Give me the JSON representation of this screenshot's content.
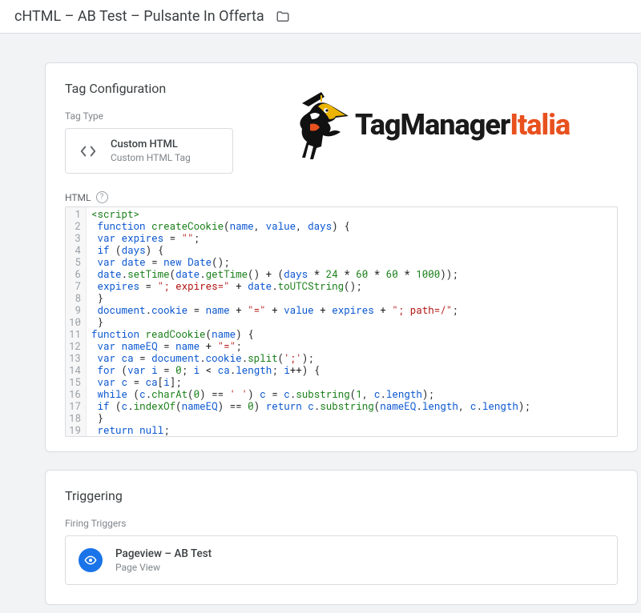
{
  "header": {
    "title": "cHTML – AB Test – Pulsante In Offerta"
  },
  "tag_config": {
    "section_title": "Tag Configuration",
    "tag_type_label": "Tag Type",
    "tag_type": {
      "primary": "Custom HTML",
      "secondary": "Custom HTML Tag"
    },
    "html_label": "HTML",
    "help_glyph": "?"
  },
  "logo": {
    "text_black": "TagManager",
    "text_orange": "Italia"
  },
  "triggering": {
    "section_title": "Triggering",
    "firing_label": "Firing Triggers",
    "trigger": {
      "primary": "Pageview – AB Test",
      "secondary": "Page View"
    }
  },
  "code": {
    "lines": [
      {
        "n": "1",
        "tokens": [
          {
            "c": "t-tag",
            "t": "<script>"
          }
        ]
      },
      {
        "n": "2",
        "tokens": [
          {
            "c": "t-plain",
            "t": " "
          },
          {
            "c": "t-key",
            "t": "function"
          },
          {
            "c": "t-plain",
            "t": " "
          },
          {
            "c": "t-fn",
            "t": "createCookie"
          },
          {
            "c": "t-plain",
            "t": "("
          },
          {
            "c": "t-id",
            "t": "name"
          },
          {
            "c": "t-plain",
            "t": ", "
          },
          {
            "c": "t-id",
            "t": "value"
          },
          {
            "c": "t-plain",
            "t": ", "
          },
          {
            "c": "t-id",
            "t": "days"
          },
          {
            "c": "t-plain",
            "t": ") {"
          }
        ]
      },
      {
        "n": "3",
        "tokens": [
          {
            "c": "t-plain",
            "t": " "
          },
          {
            "c": "t-key",
            "t": "var"
          },
          {
            "c": "t-plain",
            "t": " "
          },
          {
            "c": "t-id",
            "t": "expires"
          },
          {
            "c": "t-plain",
            "t": " = "
          },
          {
            "c": "t-str",
            "t": "\"\""
          },
          {
            "c": "t-plain",
            "t": ";"
          }
        ]
      },
      {
        "n": "4",
        "tokens": [
          {
            "c": "t-plain",
            "t": " "
          },
          {
            "c": "t-key",
            "t": "if"
          },
          {
            "c": "t-plain",
            "t": " ("
          },
          {
            "c": "t-id",
            "t": "days"
          },
          {
            "c": "t-plain",
            "t": ") {"
          }
        ]
      },
      {
        "n": "5",
        "tokens": [
          {
            "c": "t-plain",
            "t": " "
          },
          {
            "c": "t-key",
            "t": "var"
          },
          {
            "c": "t-plain",
            "t": " "
          },
          {
            "c": "t-id",
            "t": "date"
          },
          {
            "c": "t-plain",
            "t": " = "
          },
          {
            "c": "t-key",
            "t": "new"
          },
          {
            "c": "t-plain",
            "t": " "
          },
          {
            "c": "t-id",
            "t": "Date"
          },
          {
            "c": "t-plain",
            "t": "();"
          }
        ]
      },
      {
        "n": "6",
        "tokens": [
          {
            "c": "t-plain",
            "t": " "
          },
          {
            "c": "t-id",
            "t": "date"
          },
          {
            "c": "t-plain",
            "t": "."
          },
          {
            "c": "t-fn",
            "t": "setTime"
          },
          {
            "c": "t-plain",
            "t": "("
          },
          {
            "c": "t-id",
            "t": "date"
          },
          {
            "c": "t-plain",
            "t": "."
          },
          {
            "c": "t-fn",
            "t": "getTime"
          },
          {
            "c": "t-plain",
            "t": "() + ("
          },
          {
            "c": "t-id",
            "t": "days"
          },
          {
            "c": "t-plain",
            "t": " * "
          },
          {
            "c": "t-num",
            "t": "24"
          },
          {
            "c": "t-plain",
            "t": " * "
          },
          {
            "c": "t-num",
            "t": "60"
          },
          {
            "c": "t-plain",
            "t": " * "
          },
          {
            "c": "t-num",
            "t": "60"
          },
          {
            "c": "t-plain",
            "t": " * "
          },
          {
            "c": "t-num",
            "t": "1000"
          },
          {
            "c": "t-plain",
            "t": "));"
          }
        ]
      },
      {
        "n": "7",
        "tokens": [
          {
            "c": "t-plain",
            "t": " "
          },
          {
            "c": "t-id",
            "t": "expires"
          },
          {
            "c": "t-plain",
            "t": " = "
          },
          {
            "c": "t-str",
            "t": "\"; expires=\""
          },
          {
            "c": "t-plain",
            "t": " + "
          },
          {
            "c": "t-id",
            "t": "date"
          },
          {
            "c": "t-plain",
            "t": "."
          },
          {
            "c": "t-fn",
            "t": "toUTCString"
          },
          {
            "c": "t-plain",
            "t": "();"
          }
        ]
      },
      {
        "n": "8",
        "tokens": [
          {
            "c": "t-plain",
            "t": " }"
          }
        ]
      },
      {
        "n": "9",
        "tokens": [
          {
            "c": "t-plain",
            "t": " "
          },
          {
            "c": "t-id",
            "t": "document"
          },
          {
            "c": "t-plain",
            "t": "."
          },
          {
            "c": "t-id",
            "t": "cookie"
          },
          {
            "c": "t-plain",
            "t": " = "
          },
          {
            "c": "t-id",
            "t": "name"
          },
          {
            "c": "t-plain",
            "t": " + "
          },
          {
            "c": "t-str",
            "t": "\"=\""
          },
          {
            "c": "t-plain",
            "t": " + "
          },
          {
            "c": "t-id",
            "t": "value"
          },
          {
            "c": "t-plain",
            "t": " + "
          },
          {
            "c": "t-id",
            "t": "expires"
          },
          {
            "c": "t-plain",
            "t": " + "
          },
          {
            "c": "t-str",
            "t": "\"; path=/\""
          },
          {
            "c": "t-plain",
            "t": ";"
          }
        ]
      },
      {
        "n": "10",
        "tokens": [
          {
            "c": "t-plain",
            "t": " }"
          }
        ]
      },
      {
        "n": "11",
        "tokens": [
          {
            "c": "t-key",
            "t": "function"
          },
          {
            "c": "t-plain",
            "t": " "
          },
          {
            "c": "t-fn",
            "t": "readCookie"
          },
          {
            "c": "t-plain",
            "t": "("
          },
          {
            "c": "t-id",
            "t": "name"
          },
          {
            "c": "t-plain",
            "t": ") {"
          }
        ]
      },
      {
        "n": "12",
        "tokens": [
          {
            "c": "t-plain",
            "t": " "
          },
          {
            "c": "t-key",
            "t": "var"
          },
          {
            "c": "t-plain",
            "t": " "
          },
          {
            "c": "t-id",
            "t": "nameEQ"
          },
          {
            "c": "t-plain",
            "t": " = "
          },
          {
            "c": "t-id",
            "t": "name"
          },
          {
            "c": "t-plain",
            "t": " + "
          },
          {
            "c": "t-str",
            "t": "\"=\""
          },
          {
            "c": "t-plain",
            "t": ";"
          }
        ]
      },
      {
        "n": "13",
        "tokens": [
          {
            "c": "t-plain",
            "t": " "
          },
          {
            "c": "t-key",
            "t": "var"
          },
          {
            "c": "t-plain",
            "t": " "
          },
          {
            "c": "t-id",
            "t": "ca"
          },
          {
            "c": "t-plain",
            "t": " = "
          },
          {
            "c": "t-id",
            "t": "document"
          },
          {
            "c": "t-plain",
            "t": "."
          },
          {
            "c": "t-id",
            "t": "cookie"
          },
          {
            "c": "t-plain",
            "t": "."
          },
          {
            "c": "t-fn",
            "t": "split"
          },
          {
            "c": "t-plain",
            "t": "("
          },
          {
            "c": "t-str",
            "t": "';'"
          },
          {
            "c": "t-plain",
            "t": ");"
          }
        ]
      },
      {
        "n": "14",
        "tokens": [
          {
            "c": "t-plain",
            "t": " "
          },
          {
            "c": "t-key",
            "t": "for"
          },
          {
            "c": "t-plain",
            "t": " ("
          },
          {
            "c": "t-key",
            "t": "var"
          },
          {
            "c": "t-plain",
            "t": " "
          },
          {
            "c": "t-id",
            "t": "i"
          },
          {
            "c": "t-plain",
            "t": " = "
          },
          {
            "c": "t-num",
            "t": "0"
          },
          {
            "c": "t-plain",
            "t": "; "
          },
          {
            "c": "t-id",
            "t": "i"
          },
          {
            "c": "t-plain",
            "t": " < "
          },
          {
            "c": "t-id",
            "t": "ca"
          },
          {
            "c": "t-plain",
            "t": "."
          },
          {
            "c": "t-id",
            "t": "length"
          },
          {
            "c": "t-plain",
            "t": "; "
          },
          {
            "c": "t-id",
            "t": "i"
          },
          {
            "c": "t-plain",
            "t": "++) {"
          }
        ]
      },
      {
        "n": "15",
        "tokens": [
          {
            "c": "t-plain",
            "t": " "
          },
          {
            "c": "t-key",
            "t": "var"
          },
          {
            "c": "t-plain",
            "t": " "
          },
          {
            "c": "t-id",
            "t": "c"
          },
          {
            "c": "t-plain",
            "t": " = "
          },
          {
            "c": "t-id",
            "t": "ca"
          },
          {
            "c": "t-plain",
            "t": "["
          },
          {
            "c": "t-id",
            "t": "i"
          },
          {
            "c": "t-plain",
            "t": "];"
          }
        ]
      },
      {
        "n": "16",
        "tokens": [
          {
            "c": "t-plain",
            "t": " "
          },
          {
            "c": "t-key",
            "t": "while"
          },
          {
            "c": "t-plain",
            "t": " ("
          },
          {
            "c": "t-id",
            "t": "c"
          },
          {
            "c": "t-plain",
            "t": "."
          },
          {
            "c": "t-fn",
            "t": "charAt"
          },
          {
            "c": "t-plain",
            "t": "("
          },
          {
            "c": "t-num",
            "t": "0"
          },
          {
            "c": "t-plain",
            "t": ") == "
          },
          {
            "c": "t-str",
            "t": "' '"
          },
          {
            "c": "t-plain",
            "t": ") "
          },
          {
            "c": "t-id",
            "t": "c"
          },
          {
            "c": "t-plain",
            "t": " = "
          },
          {
            "c": "t-id",
            "t": "c"
          },
          {
            "c": "t-plain",
            "t": "."
          },
          {
            "c": "t-fn",
            "t": "substring"
          },
          {
            "c": "t-plain",
            "t": "("
          },
          {
            "c": "t-num",
            "t": "1"
          },
          {
            "c": "t-plain",
            "t": ", "
          },
          {
            "c": "t-id",
            "t": "c"
          },
          {
            "c": "t-plain",
            "t": "."
          },
          {
            "c": "t-id",
            "t": "length"
          },
          {
            "c": "t-plain",
            "t": ");"
          }
        ]
      },
      {
        "n": "17",
        "tokens": [
          {
            "c": "t-plain",
            "t": " "
          },
          {
            "c": "t-key",
            "t": "if"
          },
          {
            "c": "t-plain",
            "t": " ("
          },
          {
            "c": "t-id",
            "t": "c"
          },
          {
            "c": "t-plain",
            "t": "."
          },
          {
            "c": "t-fn",
            "t": "indexOf"
          },
          {
            "c": "t-plain",
            "t": "("
          },
          {
            "c": "t-id",
            "t": "nameEQ"
          },
          {
            "c": "t-plain",
            "t": ") == "
          },
          {
            "c": "t-num",
            "t": "0"
          },
          {
            "c": "t-plain",
            "t": ") "
          },
          {
            "c": "t-key",
            "t": "return"
          },
          {
            "c": "t-plain",
            "t": " "
          },
          {
            "c": "t-id",
            "t": "c"
          },
          {
            "c": "t-plain",
            "t": "."
          },
          {
            "c": "t-fn",
            "t": "substring"
          },
          {
            "c": "t-plain",
            "t": "("
          },
          {
            "c": "t-id",
            "t": "nameEQ"
          },
          {
            "c": "t-plain",
            "t": "."
          },
          {
            "c": "t-id",
            "t": "length"
          },
          {
            "c": "t-plain",
            "t": ", "
          },
          {
            "c": "t-id",
            "t": "c"
          },
          {
            "c": "t-plain",
            "t": "."
          },
          {
            "c": "t-id",
            "t": "length"
          },
          {
            "c": "t-plain",
            "t": ");"
          }
        ]
      },
      {
        "n": "18",
        "tokens": [
          {
            "c": "t-plain",
            "t": " }"
          }
        ]
      },
      {
        "n": "19",
        "tokens": [
          {
            "c": "t-plain",
            "t": " "
          },
          {
            "c": "t-key",
            "t": "return"
          },
          {
            "c": "t-plain",
            "t": " "
          },
          {
            "c": "t-key",
            "t": "null"
          },
          {
            "c": "t-plain",
            "t": ";"
          }
        ]
      }
    ]
  }
}
